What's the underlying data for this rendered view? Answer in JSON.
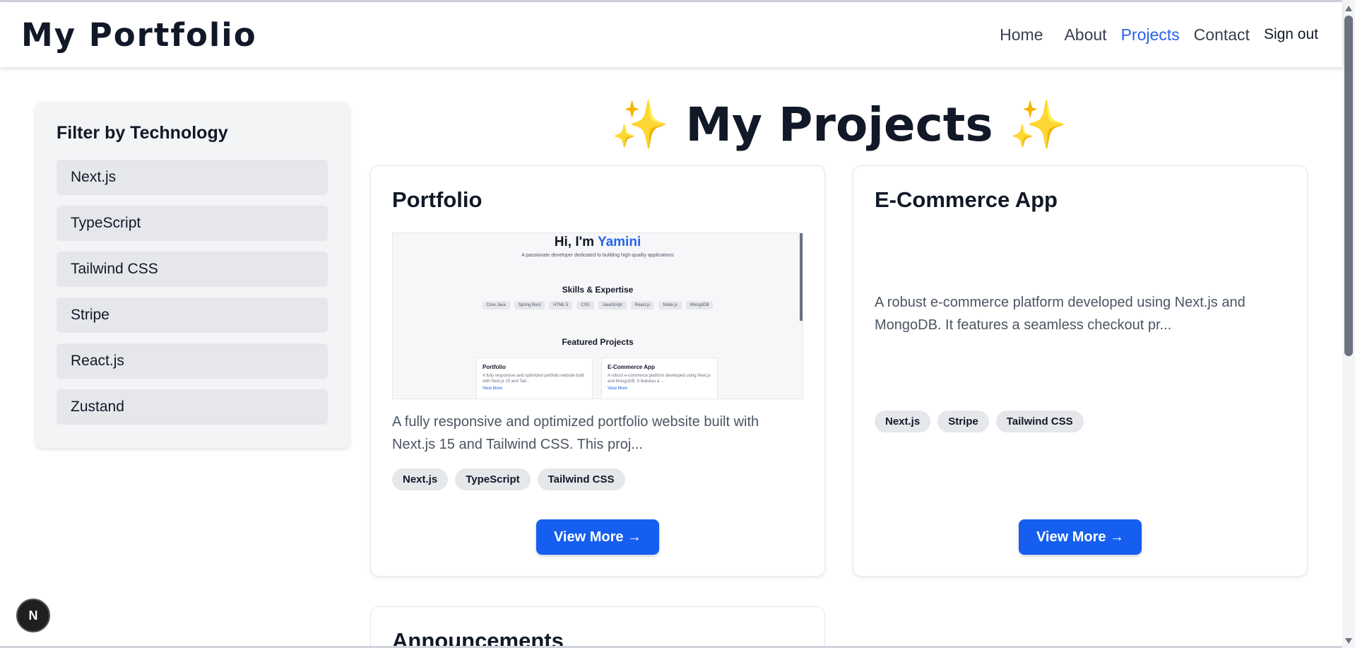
{
  "header": {
    "logo": "My Portfolio",
    "nav": [
      "Home",
      "About",
      "Projects",
      "Contact",
      "Sign out"
    ],
    "active_nav": "Projects"
  },
  "sidebar": {
    "title": "Filter by Technology",
    "filters": [
      "Next.js",
      "TypeScript",
      "Tailwind CSS",
      "Stripe",
      "React.js",
      "Zustand"
    ]
  },
  "main": {
    "title_sparkle": "✨",
    "title": "My Projects",
    "projects": [
      {
        "title": "Portfolio",
        "description": "A fully responsive and optimized portfolio website built with Next.js 15 and Tailwind CSS. This proj...",
        "tags": [
          "Next.js",
          "TypeScript",
          "Tailwind CSS"
        ],
        "button": "View More →",
        "preview": {
          "greeting": "Hi, I'm ",
          "name": "Yamini",
          "subtitle": "A passionate developer dedicated to building high-quality applications",
          "skills_heading": "Skills & Expertise",
          "skills": [
            "Core Java",
            "Spring Boot",
            "HTML 5",
            "CSS",
            "JavaScript",
            "React.js",
            "Node.js",
            "MongoDB"
          ],
          "featured_heading": "Featured Projects",
          "cards": [
            {
              "title": "Portfolio",
              "desc": "A fully responsive and optimized portfolio website built with Next.js 15 and Tail...",
              "link": "View More"
            },
            {
              "title": "E-Commerce App",
              "desc": "A robust e-commerce platform developed using Next.js and MongoDB. It features a ...",
              "link": "View More"
            }
          ]
        }
      },
      {
        "title": "E-Commerce App",
        "description": "A robust e-commerce platform developed using Next.js and MongoDB. It features a seamless checkout pr...",
        "tags": [
          "Next.js",
          "Stripe",
          "Tailwind CSS"
        ],
        "button": "View More →"
      }
    ],
    "announcements_title": "Announcements"
  },
  "badge": "N",
  "colors": {
    "accent": "#155eef",
    "nav_active": "#2563eb",
    "sidebar_bg": "#f3f4f6",
    "chip_bg": "#e5e7eb"
  }
}
